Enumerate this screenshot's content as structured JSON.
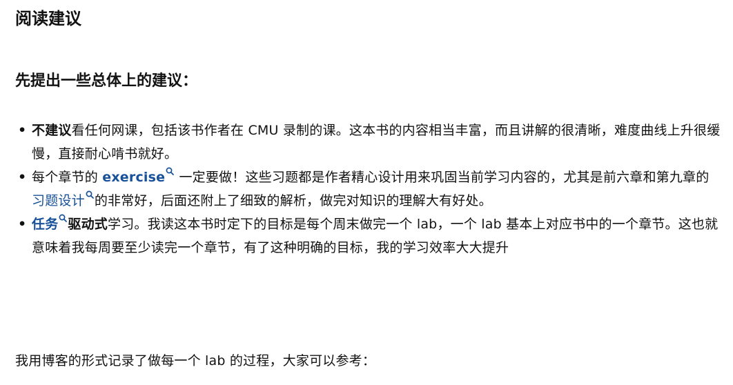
{
  "heading": "阅读建议",
  "subheading": "先提出一些总体上的建议：",
  "items": [
    {
      "bold": "不建议",
      "text": "看任何网课，包括该书作者在 CMU 录制的课。这本书的内容相当丰富，而且讲解的很清晰，难度曲线上升很缓慢，直接耐心啃书就好。"
    },
    {
      "pre": "每个章节的 ",
      "link": "exercise",
      "mid": " 一定要做！这些习题都是作者精心设计用来巩固当前学习内容的，尤其是前六章和第九章的",
      "link2": "习题设计",
      "post": "的非常好，后面还附上了细致的解析，做完对知识的理解大有好处。"
    },
    {
      "link": "任务",
      "bold": "驱动式",
      "text": "学习。我读这本书时定下的目标是每个周末做完一个 lab，一个 lab 基本上对应书中的一个章节。这也就意味着我每周要至少读完一个章节，有了这种明确的目标，我的学习效率大大提升"
    }
  ],
  "bullet": "•",
  "closing": "我用博客的形式记录了做每一个 lab 的过程，大家可以参考：",
  "colors": {
    "link": "#175199",
    "text": "#121212"
  }
}
